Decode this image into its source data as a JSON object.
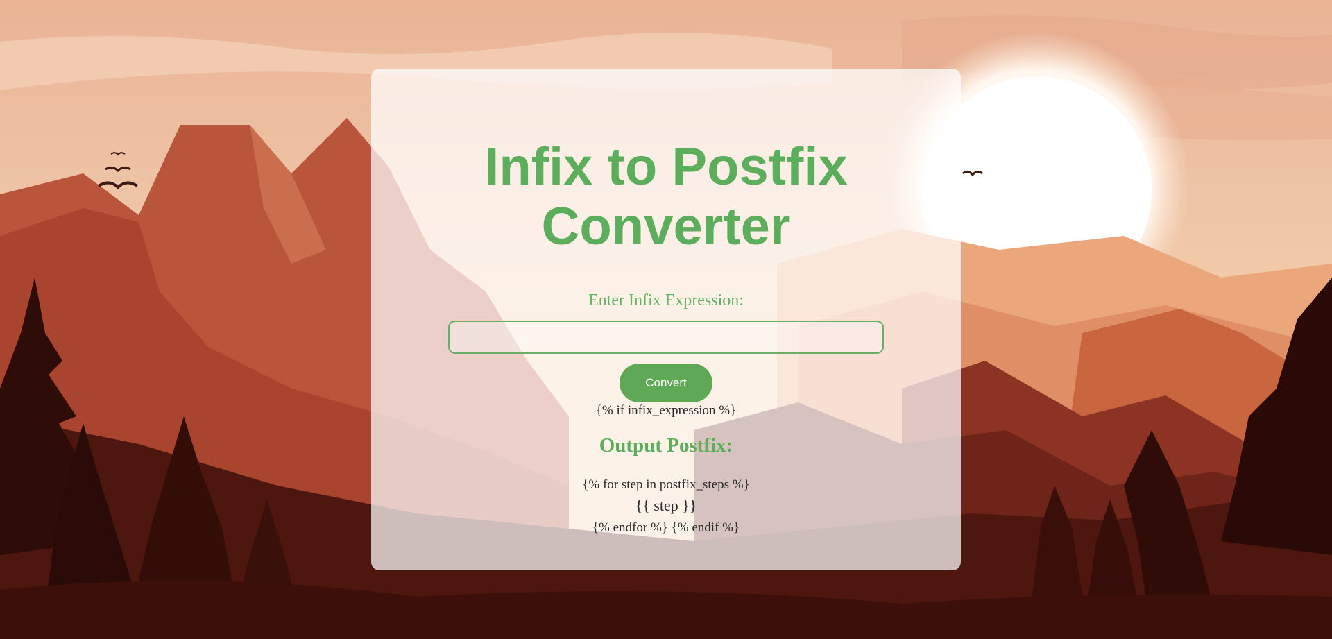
{
  "page": {
    "title_line1": "Infix to Postfix",
    "title_line2": "Converter"
  },
  "form": {
    "label": "Enter Infix Expression:",
    "input_value": "",
    "input_placeholder": "",
    "button_label": "Convert"
  },
  "template": {
    "if_line": "{% if infix_expression %}",
    "output_heading": "Output Postfix:",
    "for_line": "{% for step in postfix_steps %}",
    "step_line": "{{ step }}",
    "end_line": "{% endfor %} {% endif %}"
  },
  "colors": {
    "accent": "#5cad5c",
    "button": "#5fa856"
  }
}
